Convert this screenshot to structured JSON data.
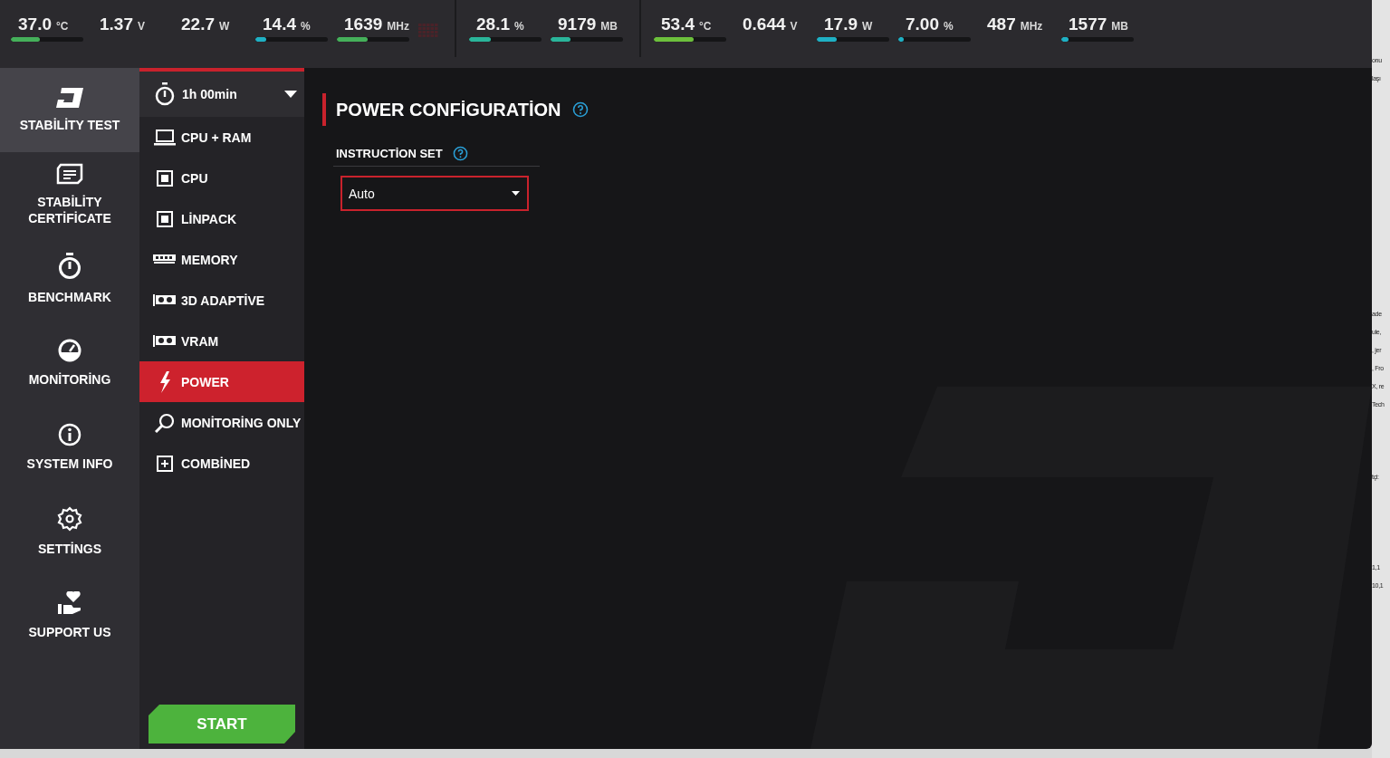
{
  "monitor_groups": [
    {
      "metrics": [
        {
          "value": "37.0",
          "unit": "°C",
          "level": 0.4,
          "color": "#45b05a"
        },
        {
          "value": "1.37",
          "unit": "V"
        },
        {
          "value": "22.7",
          "unit": "W"
        },
        {
          "value": "14.4",
          "unit": "%",
          "level": 0.15,
          "color": "#1fb0c4"
        },
        {
          "value": "1639",
          "unit": "MHz",
          "level": 0.42,
          "color": "#45b05a"
        }
      ],
      "grid_icon": true
    },
    {
      "metrics": [
        {
          "value": "28.1",
          "unit": "%",
          "level": 0.3,
          "color": "#2ab59a"
        },
        {
          "value": "9179",
          "unit": "MB",
          "level": 0.28,
          "color": "#2ab59a"
        }
      ]
    },
    {
      "metrics": [
        {
          "value": "53.4",
          "unit": "°C",
          "level": 0.55,
          "color": "#6cc03c"
        },
        {
          "value": "0.644",
          "unit": "V"
        },
        {
          "value": "17.9",
          "unit": "W",
          "level": 0.28,
          "color": "#1fb0c4"
        },
        {
          "value": "7.00",
          "unit": "%",
          "level": 0.07,
          "color": "#1fb0c4"
        },
        {
          "value": "487",
          "unit": "MHz"
        },
        {
          "value": "1577",
          "unit": "MB",
          "level": 0.1,
          "color": "#1fb0c4"
        }
      ]
    }
  ],
  "sidebar": {
    "items": [
      {
        "kind": "logo",
        "label": "STABİLİTY TEST",
        "selected": true
      },
      {
        "kind": "certificate",
        "label": "STABİLİTY CERTİFİCATE",
        "selected": false
      },
      {
        "kind": "stopwatch",
        "label": "BENCHMARK",
        "selected": false
      },
      {
        "kind": "gauge",
        "label": "MONİTORİNG",
        "selected": false
      },
      {
        "kind": "info",
        "label": "SYSTEM INFO",
        "selected": false
      },
      {
        "kind": "gear",
        "label": "SETTİNGS",
        "selected": false
      },
      {
        "kind": "heart-hand",
        "label": "SUPPORT US",
        "selected": false
      }
    ]
  },
  "duration": {
    "value": "1h 00min"
  },
  "tests": [
    {
      "kind": "laptop",
      "label": "CPU + RAM",
      "selected": false
    },
    {
      "kind": "chip",
      "label": "CPU",
      "selected": false
    },
    {
      "kind": "chip",
      "label": "LİNPACK",
      "selected": false
    },
    {
      "kind": "ram",
      "label": "MEMORY",
      "selected": false
    },
    {
      "kind": "gpu",
      "label": "3D ADAPTİVE",
      "selected": false
    },
    {
      "kind": "gpu",
      "label": "VRAM",
      "selected": false
    },
    {
      "kind": "bolt",
      "label": "POWER",
      "selected": true
    },
    {
      "kind": "magnifier",
      "label": "MONİTORİNG ONLY",
      "selected": false
    },
    {
      "kind": "plus",
      "label": "COMBİNED",
      "selected": false
    }
  ],
  "start_button": "START",
  "config": {
    "title": "POWER CONFİGURATİON",
    "instruction_set": {
      "label": "INSTRUCTİON SET",
      "value": "Auto"
    }
  },
  "background_window": {
    "fragments": [
      "onu",
      "laşı",
      "ade",
      "ule,",
      ", jer",
      ", Fro",
      "X, re",
      "Tech",
      "tçi:",
      "1,1",
      "10,1"
    ]
  }
}
